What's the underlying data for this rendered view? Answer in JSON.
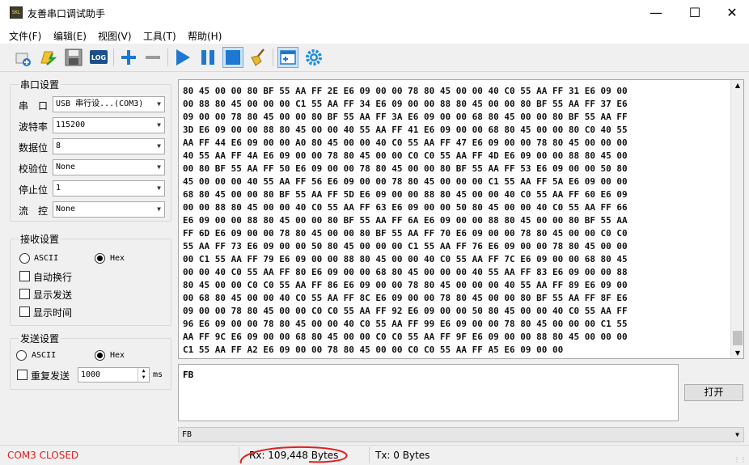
{
  "window": {
    "title": "友善串口调试助手",
    "icon_text": "SKL"
  },
  "menu": [
    "文件(F)",
    "编辑(E)",
    "视图(V)",
    "工具(T)",
    "帮助(H)"
  ],
  "toolbar": {
    "log_label": "LOG"
  },
  "serial": {
    "group_title": "串口设置",
    "port_label": "串　口",
    "port_value": "USB 串行设...(COM3)",
    "baud_label": "波特率",
    "baud_value": "115200",
    "databits_label": "数据位",
    "databits_value": "8",
    "parity_label": "校验位",
    "parity_value": "None",
    "stopbits_label": "停止位",
    "stopbits_value": "1",
    "flow_label": "流　控",
    "flow_value": "None"
  },
  "receive": {
    "group_title": "接收设置",
    "ascii_label": "ASCII",
    "hex_label": "Hex",
    "selected": "Hex",
    "auto_wrap_label": "自动换行",
    "show_send_label": "显示发送",
    "show_time_label": "显示时间",
    "lines": [
      "80 45 00 00 80 BF 55 AA FF 2E E6 09 00 00 78 80 45 00 00 40 C0 55 AA FF 31 E6 09 00",
      "00 88 80 45 00 00 00 C1 55 AA FF 34 E6 09 00 00 88 80 45 00 00 80 BF 55 AA FF 37 E6",
      "09 00 00 78 80 45 00 00 80 BF 55 AA FF 3A E6 09 00 00 68 80 45 00 00 80 BF 55 AA FF",
      "3D E6 09 00 00 88 80 45 00 00 40 55 AA FF 41 E6 09 00 00 68 80 45 00 00 80 C0 40 55",
      "AA FF 44 E6 09 00 00 A0 80 45 00 00 40 C0 55 AA FF 47 E6 09 00 00 78 80 45 00 00 00",
      "40 55 AA FF 4A E6 09 00 00 78 80 45 00 00 C0 C0 55 AA FF 4D E6 09 00 00 88 80 45 00",
      "00 80 BF 55 AA FF 50 E6 09 00 00 78 80 45 00 00 80 BF 55 AA FF 53 E6 09 00 00 50 80",
      "45 00 00 00 40 55 AA FF 56 E6 09 00 00 78 80 45 00 00 00 C1 55 AA FF 5A E6 09 00 00",
      "68 80 45 00 00 80 BF 55 AA FF 5D E6 09 00 00 88 80 45 00 00 40 C0 55 AA FF 60 E6 09",
      "00 00 88 80 45 00 00 40 C0 55 AA FF 63 E6 09 00 00 50 80 45 00 00 40 C0 55 AA FF 66",
      "E6 09 00 00 88 80 45 00 00 80 BF 55 AA FF 6A E6 09 00 00 88 80 45 00 00 80 BF 55 AA",
      "FF 6D E6 09 00 00 78 80 45 00 00 80 BF 55 AA FF 70 E6 09 00 00 78 80 45 00 00 C0 C0",
      "55 AA FF 73 E6 09 00 00 50 80 45 00 00 00 C1 55 AA FF 76 E6 09 00 00 78 80 45 00 00",
      "00 C1 55 AA FF 79 E6 09 00 00 88 80 45 00 00 40 C0 55 AA FF 7C E6 09 00 00 68 80 45",
      "00 00 40 C0 55 AA FF 80 E6 09 00 00 68 80 45 00 00 00 40 55 AA FF 83 E6 09 00 00 88",
      "80 45 00 00 C0 C0 55 AA FF 86 E6 09 00 00 78 80 45 00 00 00 40 55 AA FF 89 E6 09 00",
      "00 68 80 45 00 00 40 C0 55 AA FF 8C E6 09 00 00 78 80 45 00 00 80 BF 55 AA FF 8F E6",
      "09 00 00 78 80 45 00 00 C0 C0 55 AA FF 92 E6 09 00 00 50 80 45 00 00 40 C0 55 AA FF",
      "96 E6 09 00 00 78 80 45 00 00 40 C0 55 AA FF 99 E6 09 00 00 78 80 45 00 00 00 C1 55",
      "AA FF 9C E6 09 00 00 68 80 45 00 00 C0 C0 55 AA FF 9F E6 09 00 00 88 80 45 00 00 00",
      "C1 55 AA FF A2 E6 09 00 00 78 80 45 00 00 C0 C0 55 AA FF A5 E6 09 00 00"
    ]
  },
  "send": {
    "group_title": "发送设置",
    "ascii_label": "ASCII",
    "hex_label": "Hex",
    "selected": "Hex",
    "repeat_label": "重复发送",
    "interval_value": "1000",
    "interval_unit": "ms",
    "text": "FB",
    "history_value": "FB",
    "open_button": "打开"
  },
  "status": {
    "port_status": "COM3 CLOSED",
    "rx": "Rx: 109,448 Bytes",
    "tx": "Tx: 0 Bytes"
  },
  "colors": {
    "status_closed": "#e02020",
    "highlight_circle": "#e02020",
    "toolbar_blue": "#1e78d2"
  }
}
